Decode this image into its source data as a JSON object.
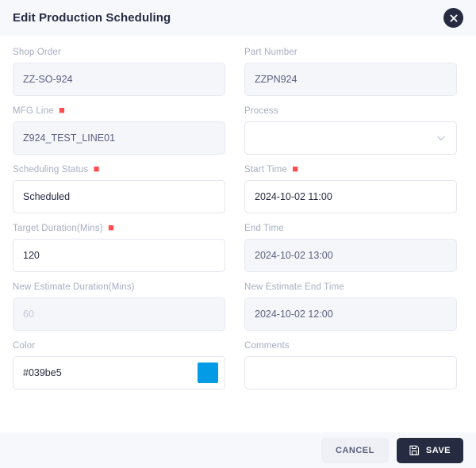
{
  "header": {
    "title": "Edit Production Scheduling",
    "close_icon": "close-icon"
  },
  "form": {
    "fields": [
      {
        "key": "shop_order",
        "label": "Shop Order",
        "required": false,
        "value": "ZZ-SO-924",
        "state": "disabled",
        "type": "text"
      },
      {
        "key": "part_number",
        "label": "Part Number",
        "required": false,
        "value": "ZZPN924",
        "state": "disabled",
        "type": "text"
      },
      {
        "key": "mfg_line",
        "label": "MFG Line",
        "required": true,
        "value": "Z924_TEST_LINE01",
        "state": "disabled",
        "type": "text"
      },
      {
        "key": "process",
        "label": "Process",
        "required": false,
        "value": "",
        "state": "enabled",
        "type": "select",
        "icon": "chevron-down-icon"
      },
      {
        "key": "scheduling_status",
        "label": "Scheduling Status",
        "required": true,
        "value": "Scheduled",
        "state": "enabled",
        "type": "text"
      },
      {
        "key": "start_time",
        "label": "Start Time",
        "required": true,
        "value": "2024-10-02 11:00",
        "state": "enabled",
        "type": "text"
      },
      {
        "key": "target_duration",
        "label": "Target Duration(Mins)",
        "required": true,
        "value": "120",
        "state": "enabled",
        "type": "text"
      },
      {
        "key": "end_time",
        "label": "End Time",
        "required": false,
        "value": "2024-10-02 13:00",
        "state": "disabled",
        "type": "text"
      },
      {
        "key": "new_estimate_duration",
        "label": "New Estimate Duration(Mins)",
        "required": false,
        "value": "",
        "placeholder": "60",
        "state": "disabled-placeholder",
        "type": "text"
      },
      {
        "key": "new_estimate_end_time",
        "label": "New Estimate End Time",
        "required": false,
        "value": "2024-10-02 12:00",
        "state": "disabled",
        "type": "text"
      },
      {
        "key": "color",
        "label": "Color",
        "required": false,
        "value": "#039be5",
        "state": "enabled",
        "type": "color",
        "swatch": "#039be5"
      },
      {
        "key": "comments",
        "label": "Comments",
        "required": false,
        "value": "",
        "state": "enabled",
        "type": "text"
      }
    ]
  },
  "footer": {
    "cancel_label": "CANCEL",
    "save_label": "SAVE",
    "save_icon": "save-icon"
  }
}
